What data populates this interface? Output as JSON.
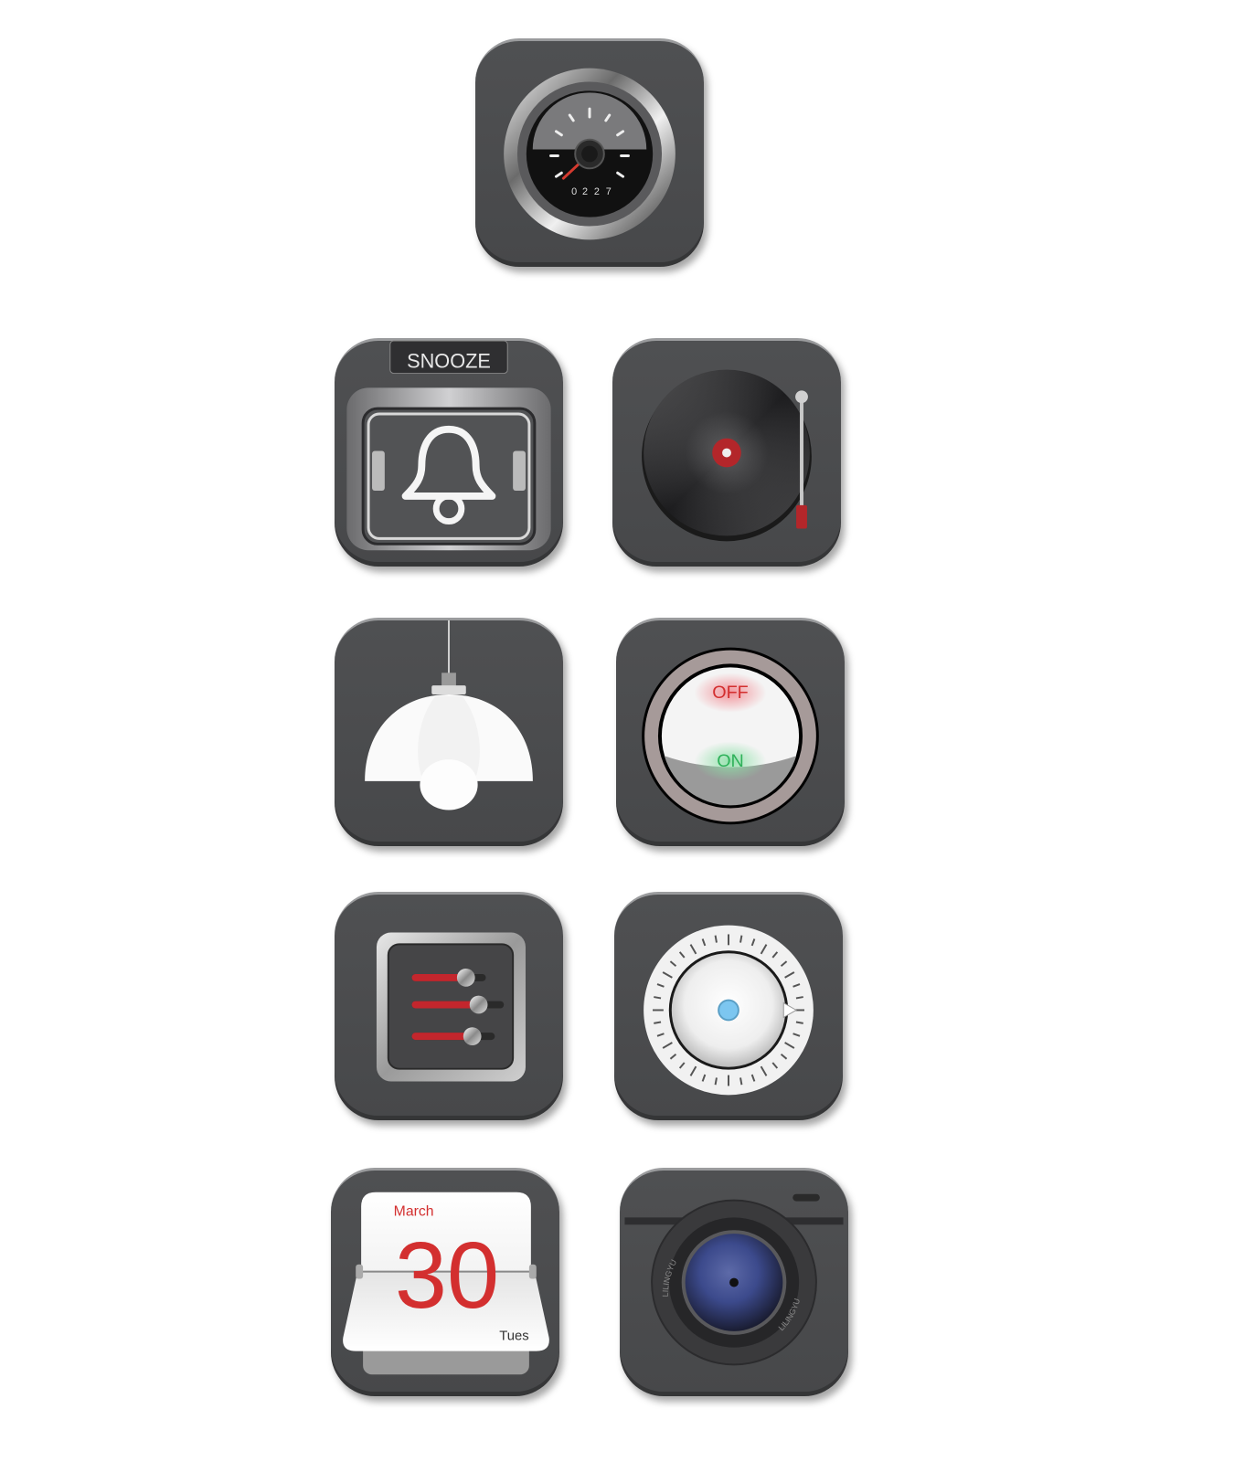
{
  "speedometer": {
    "odometer_digits": [
      "0",
      "2",
      "2",
      "7"
    ]
  },
  "alarm": {
    "snooze_label": "SNOOZE"
  },
  "power_switch": {
    "off_label": "OFF",
    "on_label": "ON"
  },
  "calendar": {
    "month": "March",
    "day": "30",
    "weekday": "Tues"
  },
  "camera": {
    "lens_brand_top": "LILINGYU",
    "lens_brand_bottom": "LILINGYU"
  },
  "colors": {
    "tile": "#4a4b4d",
    "accent_red": "#d32f2f",
    "accent_green": "#2fb15a",
    "dial_blue": "#7cc6f0"
  },
  "icons": [
    "speedometer-icon",
    "alarm-bell-icon",
    "record-player-icon",
    "pendant-lamp-icon",
    "power-switch-icon",
    "equalizer-sliders-icon",
    "dial-knob-icon",
    "flip-calendar-icon",
    "camera-lens-icon"
  ]
}
